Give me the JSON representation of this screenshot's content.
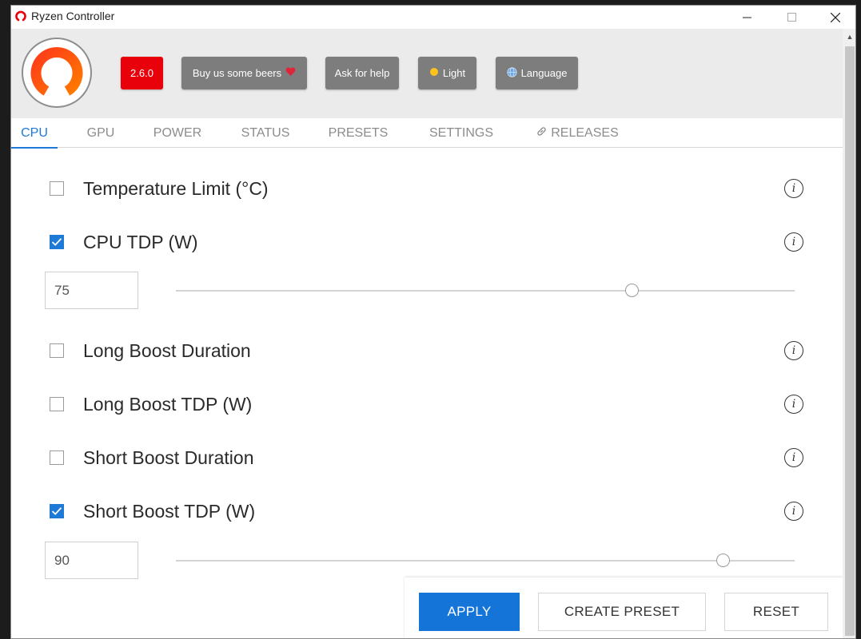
{
  "window": {
    "title": "Ryzen Controller",
    "minimize_icon": "minimize-icon",
    "maximize_icon": "maximize-icon",
    "close_icon": "close-icon"
  },
  "header": {
    "version": "2.6.0",
    "beers_label": "Buy us some beers",
    "help_label": "Ask for help",
    "theme_label": "Light",
    "language_label": "Language",
    "brand_color": "#e8000b"
  },
  "tabs": [
    {
      "label": "CPU",
      "active": true
    },
    {
      "label": "GPU"
    },
    {
      "label": "POWER"
    },
    {
      "label": "STATUS"
    },
    {
      "label": "PRESETS"
    },
    {
      "label": "SETTINGS"
    },
    {
      "label": "RELEASES",
      "icon": "link-icon"
    }
  ],
  "settings": [
    {
      "label": "Temperature Limit (°C)",
      "checked": false
    },
    {
      "label": "CPU TDP (W)",
      "checked": true,
      "value": "75",
      "slider_fraction": 0.737
    },
    {
      "label": "Long Boost Duration",
      "checked": false
    },
    {
      "label": "Long Boost TDP (W)",
      "checked": false
    },
    {
      "label": "Short Boost Duration",
      "checked": false
    },
    {
      "label": "Short Boost TDP (W)",
      "checked": true,
      "value": "90",
      "slider_fraction": 0.884
    }
  ],
  "actions": {
    "apply": "APPLY",
    "create_preset": "CREATE PRESET",
    "reset": "RESET"
  },
  "colors": {
    "accent": "#1e7ad6",
    "header_bg": "#ebebeb",
    "header_button_bg": "#7d7d7d"
  }
}
